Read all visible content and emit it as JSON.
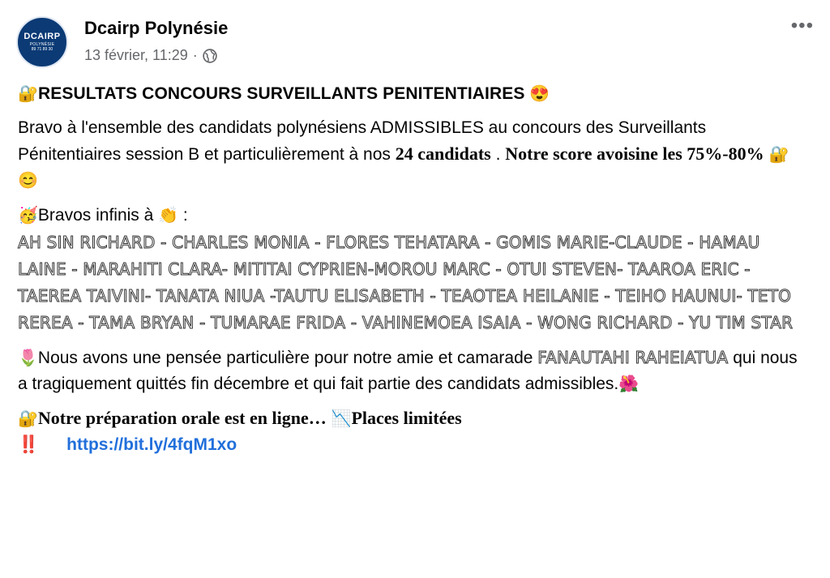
{
  "page": {
    "name": "Dcairp Polynésie",
    "date": "13 février, 11:29",
    "separator": "·",
    "more_label": "•••"
  },
  "avatar": {
    "logo_text": "DCAIRP",
    "logo_sub": "POLYNÉSIE",
    "logo_tel": "89 71 89 30"
  },
  "post": {
    "title": "RESULTATS CONCOURS SURVEILLANTS PENITENTIAIRES",
    "para1_start": "Bravo à l'ensemble des candidats polynésiens ADMISSIBLES au concours des Surveillants Pénitentiaires session B et particulièrement à nos ",
    "para1_bold1": "24 candidats",
    "para1_mid": " . ",
    "para1_bold2": "Notre score avoisine les 75%-80%",
    "bravos_label": "Bravos infinis à",
    "bravos_colon": " :",
    "names": "AH SIN RICHARD - CHARLES MONIA - FLORES TEHATARA - GOMIS MARIE-CLAUDE - HAMAU LAINE - MARAHITI CLARA- MITITAI CYPRIEN-MOROU MARC - OTUI STEVEN- TAAROA ERIC - TAEREA TAIVINI- TANATA NIUA -TAUTU ELISABETH - TEAOTEA HEILANIE - TEIHO HAUNUI- TETO REREA -  TAMA BRYAN - TUMARAE FRIDA - VAHINEMOEA ISAIA - WONG RICHARD - YU TIM STAR",
    "tribute_start": "Nous avons une pensée particulière pour notre amie et camarade ",
    "tribute_name": "FANAUTAHI RAHEIATUA",
    "tribute_end": " qui nous a tragiquement quittés fin décembre et qui fait partie des candidats admissibles.",
    "prep_text": "Notre préparation orale est en ligne…",
    "places_text": "Places limitées",
    "link": "https://bit.ly/4fqM1xo"
  }
}
